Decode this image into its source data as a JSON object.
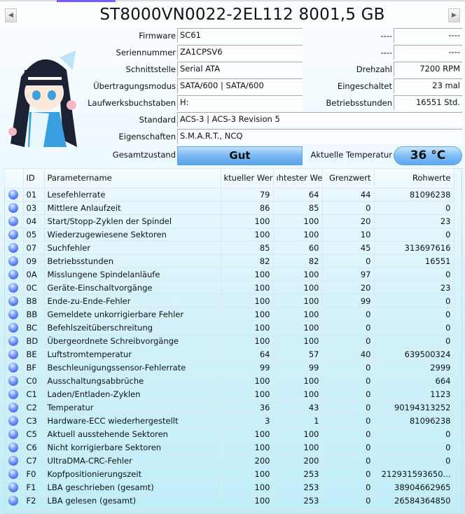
{
  "header": {
    "title": "ST8000VN0022-2EL112 8001,5 GB",
    "prev_icon": "triangle-left-icon",
    "next_icon": "triangle-right-icon"
  },
  "info_left": [
    {
      "label": "Firmware",
      "value": "SC61"
    },
    {
      "label": "Seriennummer",
      "value": "ZA1CPSV6"
    },
    {
      "label": "Schnittstelle",
      "value": "Serial ATA"
    },
    {
      "label": "Übertragungsmodus",
      "value": "SATA/600 | SATA/600"
    },
    {
      "label": "Laufwerksbuchstaben",
      "value": "H:"
    },
    {
      "label": "Standard",
      "value": "ACS-3 | ACS-3 Revision 5"
    },
    {
      "label": "Eigenschaften",
      "value": "S.M.A.R.T., NCQ"
    }
  ],
  "info_right": [
    {
      "label": "----",
      "value": "----"
    },
    {
      "label": "----",
      "value": "----"
    },
    {
      "label": "Drehzahl",
      "value": "7200 RPM"
    },
    {
      "label": "Eingeschaltet",
      "value": "23 mal"
    },
    {
      "label": "Betriebsstunden",
      "value": "16551 Std."
    }
  ],
  "health": {
    "label": "Gesamtzustand",
    "value": "Gut",
    "color": "#7ab8f2"
  },
  "temperature": {
    "label": "Aktuelle Temperatur",
    "value": "36 °C"
  },
  "table": {
    "headers": [
      "ID",
      "Parametername",
      "ktueller Wert",
      "ıhtester Wert",
      "Grenzwert",
      "Rohwerte"
    ],
    "rows": [
      [
        "01",
        "Lesefehlerrate",
        "79",
        "64",
        "44",
        "81096238"
      ],
      [
        "03",
        "Mittlere Anlaufzeit",
        "86",
        "85",
        "0",
        "0"
      ],
      [
        "04",
        "Start/Stopp-Zyklen der Spindel",
        "100",
        "100",
        "20",
        "23"
      ],
      [
        "05",
        "Wiederzugewiesene Sektoren",
        "100",
        "100",
        "10",
        "0"
      ],
      [
        "07",
        "Suchfehler",
        "85",
        "60",
        "45",
        "313697616"
      ],
      [
        "09",
        "Betriebsstunden",
        "82",
        "82",
        "0",
        "16551"
      ],
      [
        "0A",
        "Misslungene Spindelanläufe",
        "100",
        "100",
        "97",
        "0"
      ],
      [
        "0C",
        "Geräte-Einschaltvorgänge",
        "100",
        "100",
        "20",
        "23"
      ],
      [
        "B8",
        "Ende-zu-Ende-Fehler",
        "100",
        "100",
        "99",
        "0"
      ],
      [
        "BB",
        "Gemeldete unkorrigierbare Fehler",
        "100",
        "100",
        "0",
        "0"
      ],
      [
        "BC",
        "Befehlszeitüberschreitung",
        "100",
        "100",
        "0",
        "0"
      ],
      [
        "BD",
        "Übergeordnete Schreibvorgänge",
        "100",
        "100",
        "0",
        "0"
      ],
      [
        "BE",
        "Luftstromtemperatur",
        "64",
        "57",
        "40",
        "639500324"
      ],
      [
        "BF",
        "Beschleunigungssensor-Fehlerrate",
        "99",
        "99",
        "0",
        "2999"
      ],
      [
        "C0",
        "Ausschaltungsabbrüche",
        "100",
        "100",
        "0",
        "664"
      ],
      [
        "C1",
        "Laden/Entladen-Zyklen",
        "100",
        "100",
        "0",
        "1123"
      ],
      [
        "C2",
        "Temperatur",
        "36",
        "43",
        "0",
        "90194313252"
      ],
      [
        "C3",
        "Hardware-ECC wiederhergestellt",
        "3",
        "1",
        "0",
        "81096238"
      ],
      [
        "C5",
        "Aktuell ausstehende Sektoren",
        "100",
        "100",
        "0",
        "0"
      ],
      [
        "C6",
        "Nicht korrigierbare Sektoren",
        "100",
        "100",
        "0",
        "0"
      ],
      [
        "C7",
        "UltraDMA-CRC-Fehler",
        "200",
        "200",
        "0",
        "0"
      ],
      [
        "F0",
        "Kopfpositionierungszeit",
        "100",
        "253",
        "0",
        "212931593650..."
      ],
      [
        "F1",
        "LBA geschrieben (gesamt)",
        "100",
        "253",
        "0",
        "38904662965"
      ],
      [
        "F2",
        "LBA gelesen (gesamt)",
        "100",
        "253",
        "0",
        "26584364850"
      ]
    ]
  }
}
